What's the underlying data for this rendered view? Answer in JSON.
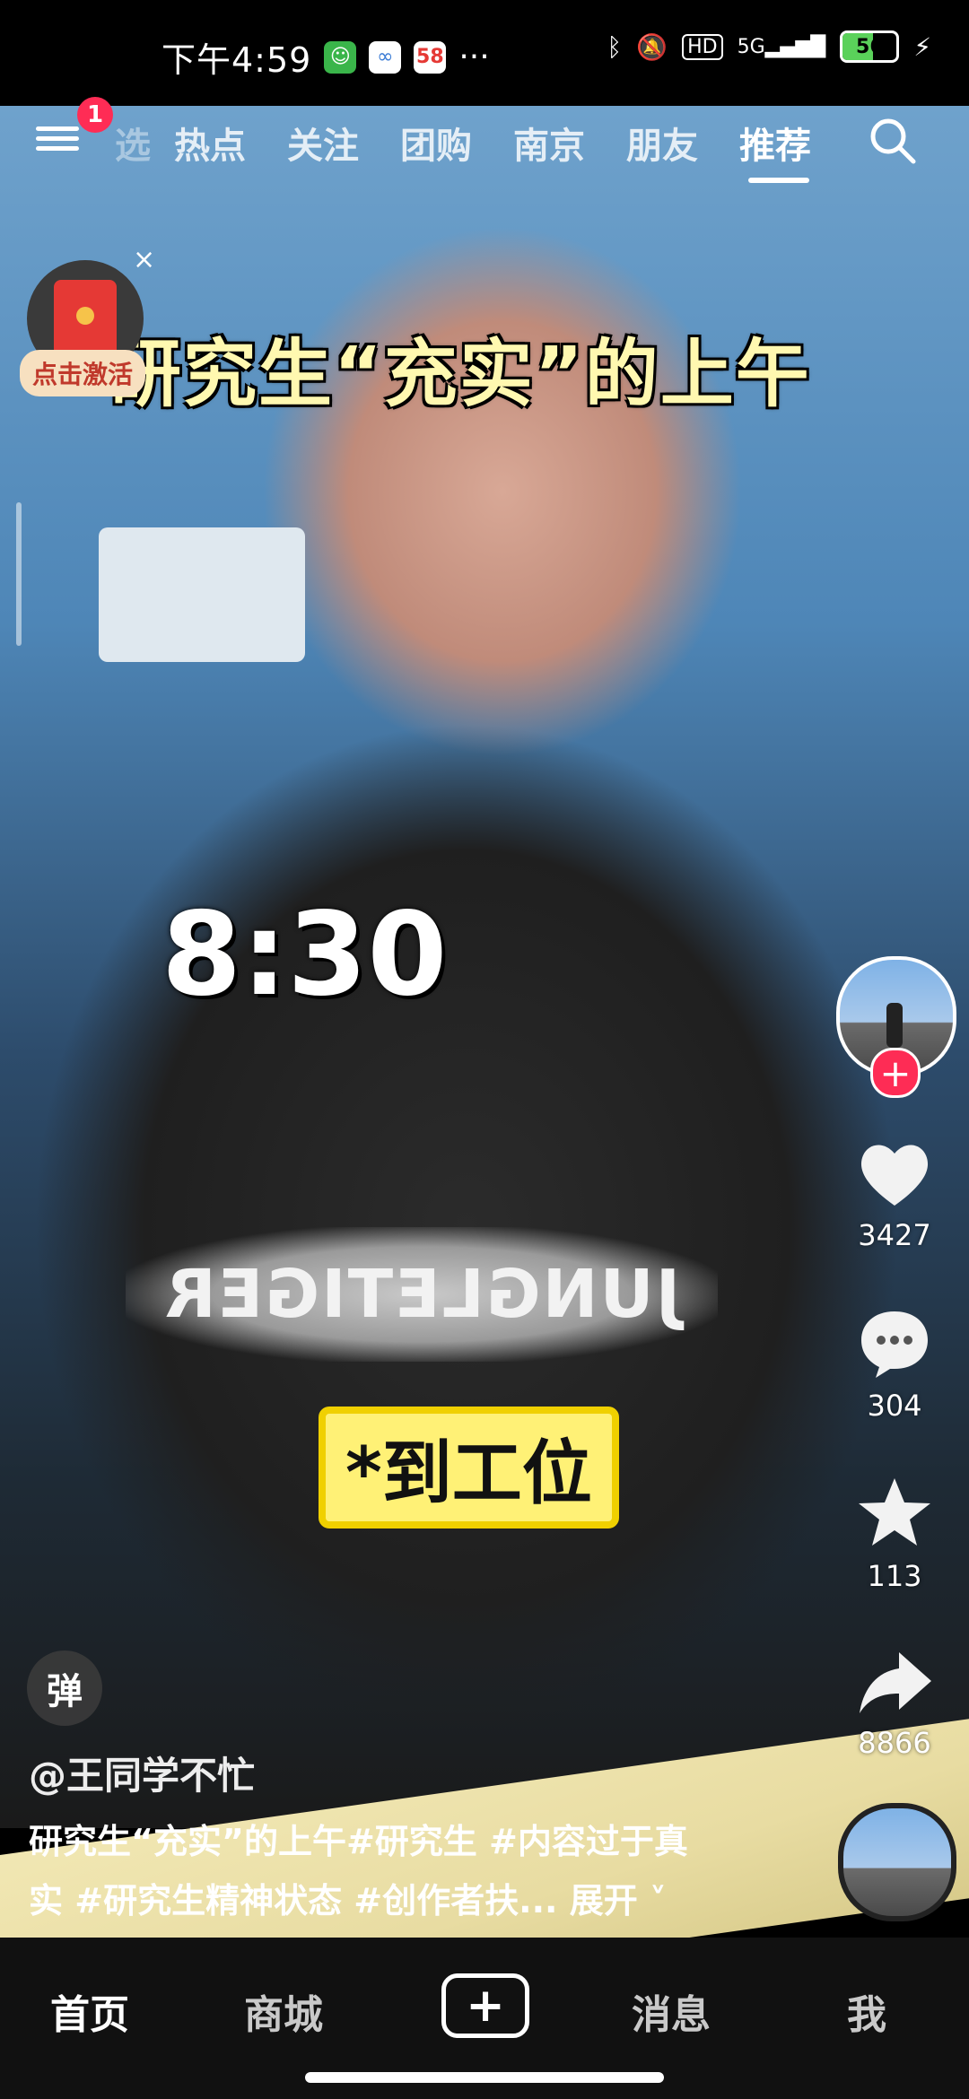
{
  "status_bar": {
    "time": "下午4:59",
    "more": "···",
    "network": "5G",
    "hd": "HD",
    "battery": "56",
    "battery_level": 0.56,
    "app_icon_label": "58"
  },
  "top_tabs": {
    "menu_badge": "1",
    "tabs": [
      "选",
      "热点",
      "关注",
      "团购",
      "南京",
      "朋友",
      "推荐"
    ],
    "active_index": 6
  },
  "red_packet": {
    "label": "点击激活",
    "close": "×"
  },
  "video": {
    "overlay_title": "研究生“充实”的上午",
    "overlay_time": "8:30",
    "overlay_sub": "*到工位",
    "shirt_text": "JUNGLETIGER"
  },
  "right_rail": {
    "follow": "+",
    "likes": "3427",
    "comments": "304",
    "favorites": "113",
    "shares": "8866"
  },
  "danmu": "弹",
  "author": "@王同学不忙",
  "description": {
    "line1": "研究生“充实”的上午#研究生 #内容过于真",
    "line2": "实 #研究生精神状态 #创作者扶...",
    "expand": "展开"
  },
  "bottom_nav": {
    "home": "首页",
    "mall": "商城",
    "add": "+",
    "messages": "消息",
    "me": "我"
  },
  "colors": {
    "accent": "#fe2c55",
    "caption_bg": "#fff176",
    "title_text": "#fff8b0"
  }
}
